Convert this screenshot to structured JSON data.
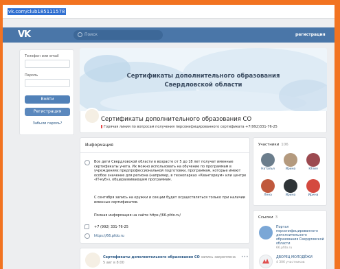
{
  "browser": {
    "url": "vk.com/club185111578"
  },
  "navbar": {
    "logo": "VK",
    "search_placeholder": "Поиск",
    "register_link": "регистрация"
  },
  "login": {
    "phone_label": "Телефон или email",
    "password_label": "Пароль",
    "login_button": "Войти",
    "register_button": "Регистрация",
    "forgot_link": "Забыли пароль?"
  },
  "cover": {
    "line1": "Сертификаты дополнительного образования",
    "line2": "Свердловской области"
  },
  "group": {
    "name": "Сертификаты дополнительного образования СО",
    "status": "Горячая линия по вопросам получения персонифицированного сертификата +7(992)331-76-25"
  },
  "info": {
    "title": "Информация",
    "paragraph1": "Все дети Свердловской области в возрасте от 5 до 18 лет получат именные сертификаты учета. Их можно использовать на обучение по программам в учреждениях предпрофессиональной подготовки, программам, которые имеют особое значение для региона (например, в технопарках «Кванториум» или центре «IT-куб»), общеразвивающим программам.",
    "paragraph2": "С сентября запись на кружки и секции будет осуществляться только при наличии именных сертификатов.",
    "paragraph3": "Полная информация на сайте https://66.pfdo.ru/",
    "phone": "+7 (992) 331-76-25",
    "website": "https://66.pfdo.ru"
  },
  "post": {
    "author": "Сертификаты дополнительного образования СО",
    "pinned_label": "запись закреплена",
    "date": "5 авг в 8:00",
    "more": "•••"
  },
  "members": {
    "title": "Участники",
    "count": "106",
    "list": [
      {
        "name": "Наталья",
        "color": "#6b7d8c"
      },
      {
        "name": "Ирина",
        "color": "#b49a7e"
      },
      {
        "name": "Юлия",
        "color": "#9c4a50"
      },
      {
        "name": "Лена",
        "color": "#c0593d"
      },
      {
        "name": "Ирина",
        "color": "#2f3437"
      },
      {
        "name": "Ирина",
        "color": "#d4493f"
      }
    ]
  },
  "links": {
    "title": "Ссылки",
    "count": "3",
    "items": [
      {
        "title": "Портал персонифицированного дополнительного образования Свердловской области",
        "sub": "66.pfdo.ru",
        "color": "#7ba7d6"
      },
      {
        "title": "ДВОРЕЦ МОЛОДЁЖИ",
        "sub": "4 306 участников",
        "color": "#f1f3f5"
      }
    ]
  }
}
